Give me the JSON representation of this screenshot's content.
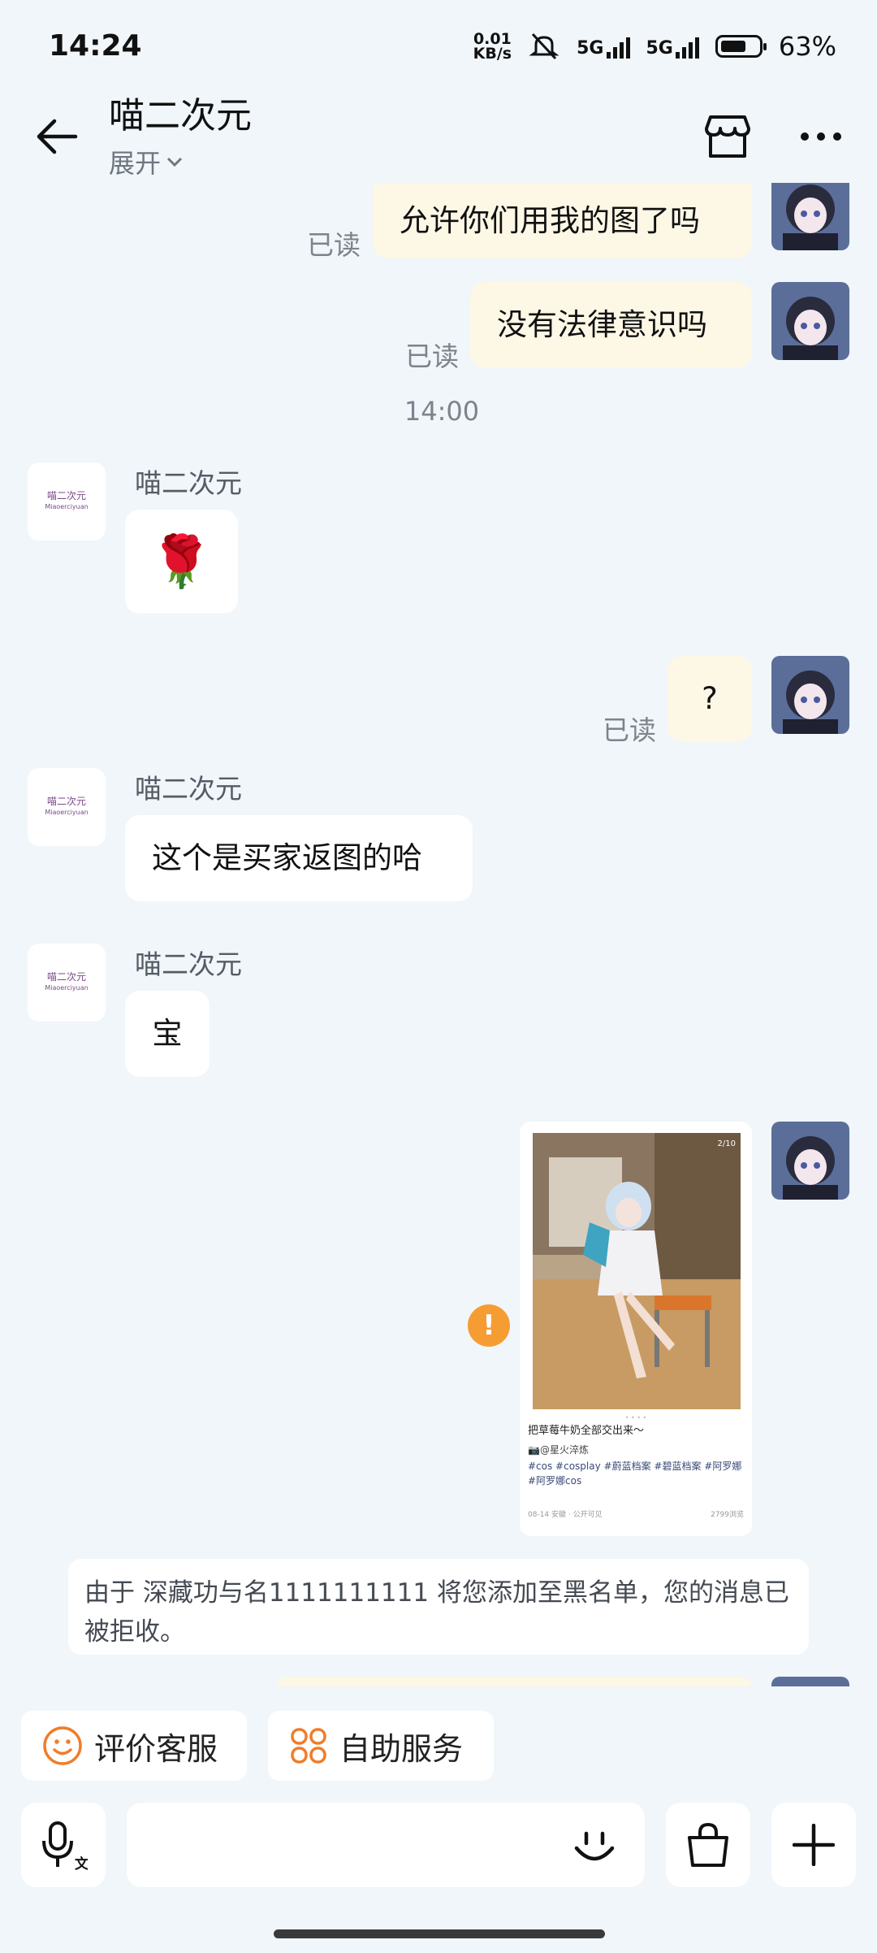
{
  "status": {
    "time": "14:24",
    "net_speed_top": "0.01",
    "net_speed_bottom": "KB/s",
    "sig1": "5G",
    "sig2": "5G",
    "battery": "63%",
    "battery_level": 0.63
  },
  "header": {
    "title": "喵二次元",
    "subtitle": "展开",
    "icons": [
      "back-arrow-icon",
      "store-icon",
      "more-icon"
    ]
  },
  "messages": {
    "m1": {
      "text": "允许你们用我的图了吗",
      "status": "已读"
    },
    "m2": {
      "text": "没有法律意识吗",
      "status": "已读"
    },
    "timestamp": "14:00",
    "m3": {
      "sender": "喵二次元",
      "emoji": "🌹"
    },
    "m4": {
      "text": "?",
      "status": "已读"
    },
    "m5": {
      "sender": "喵二次元",
      "text": "这个是买家返图的哈"
    },
    "m6": {
      "sender": "喵二次元",
      "text": "宝"
    },
    "card": {
      "page": "2/10",
      "title": "把草莓牛奶全部交出来～",
      "author": "📷@星火淬炼",
      "tags": "#cos #cosplay #蔚蓝档案 #碧蓝档案 #阿罗娜 #阿罗娜cos",
      "meta": "08-14 安徽 · 公开可见",
      "views": "2799浏览"
    },
    "warning": "!",
    "notice": "由于 深藏功与名1111111111 将您添加至黑名单，您的消息已被拒收。"
  },
  "shop_logo": {
    "cn": "喵二次元",
    "en": "Miaoerciyuan"
  },
  "quick_actions": {
    "rate": "评价客服",
    "self_service": "自助服务"
  },
  "input_bar": {
    "icons": [
      "voice-to-text-icon",
      "emoji-icon",
      "shopping-bag-icon",
      "plus-icon"
    ]
  },
  "colors": {
    "background": "#f0f6fa",
    "my_bubble": "#fdf7e6",
    "their_bubble": "#ffffff",
    "warning": "#f59d33",
    "quick_icon": "#f07c2a"
  }
}
